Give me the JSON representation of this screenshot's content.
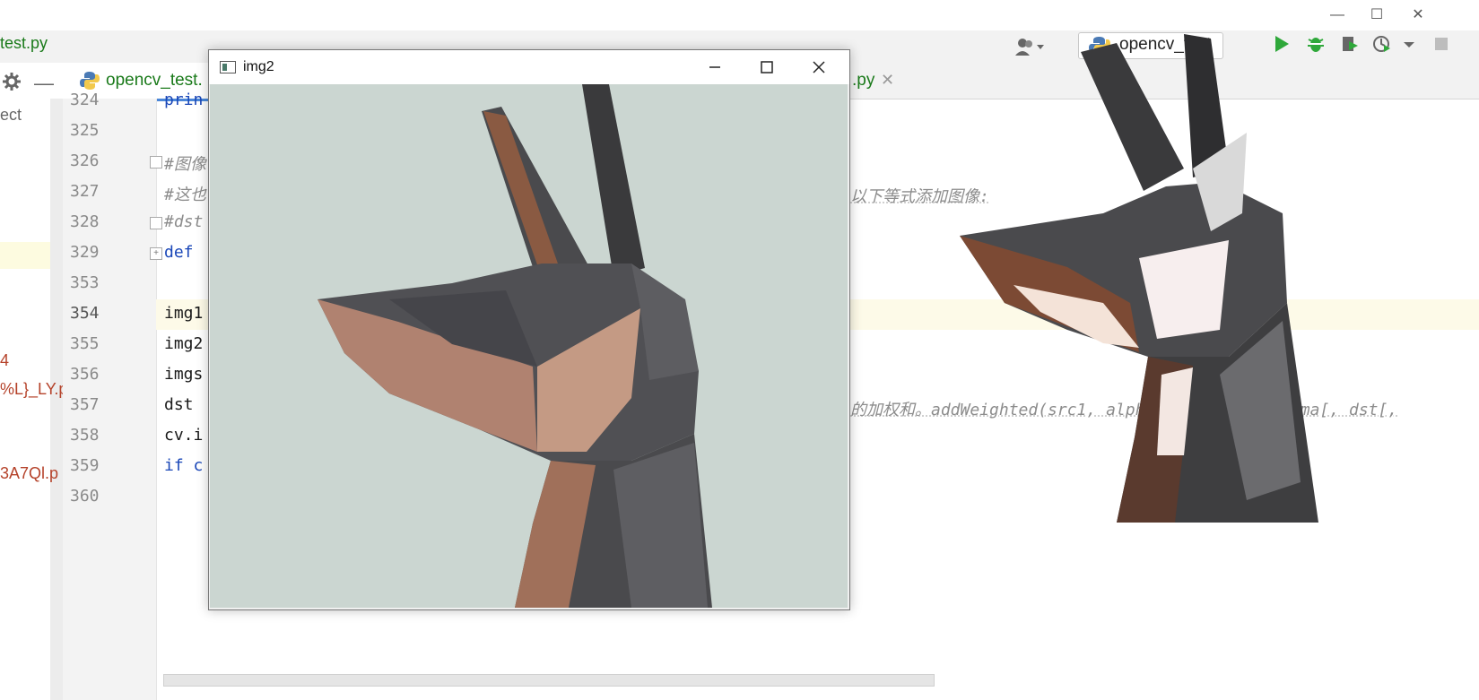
{
  "toolbar": {
    "breadcrumb": "test.py",
    "run_config": "opencv_test"
  },
  "tabs": [
    {
      "label": "opencv_test.",
      "active": true
    },
    {
      "label": ".py",
      "active": false
    }
  ],
  "project_panel": {
    "items": [
      "ect",
      "4",
      "%L}_LY.p",
      "3A7Ql.p"
    ]
  },
  "editor": {
    "line_numbers": [
      "324",
      "325",
      "326",
      "327",
      "328",
      "329",
      "353",
      "354",
      "355",
      "356",
      "357",
      "358",
      "359",
      "360"
    ],
    "lines": [
      {
        "num": "324",
        "text": "prin"
      },
      {
        "num": "325",
        "text": ""
      },
      {
        "num": "326",
        "text": "#图像"
      },
      {
        "num": "327",
        "text": "#这也"
      },
      {
        "num": "328",
        "text": "#dst"
      },
      {
        "num": "329",
        "text": "def "
      },
      {
        "num": "353",
        "text": ""
      },
      {
        "num": "354",
        "text": "img1"
      },
      {
        "num": "355",
        "text": "img2"
      },
      {
        "num": "356",
        "text": "imgs"
      },
      {
        "num": "357",
        "text": "dst "
      },
      {
        "num": "358",
        "text": "cv.i"
      },
      {
        "num": "359",
        "text": "if c"
      },
      {
        "num": "360",
        "text": ""
      }
    ],
    "ghost_327": "以下等式添加图像:",
    "ghost_357": "的加权和。addWeighted(src1, alpha, src2, ... gamma[, dst[,"
  },
  "image_window": {
    "title": "img2"
  },
  "colors": {
    "tab_accent": "#4a86d8",
    "green_text": "#1a7a1a",
    "run_green": "#2fa83a",
    "current_line": "#fdfae8"
  }
}
